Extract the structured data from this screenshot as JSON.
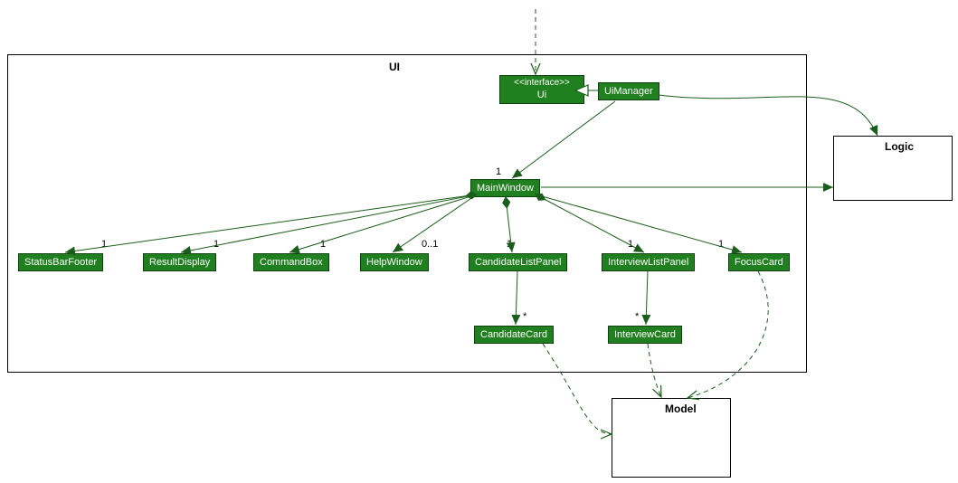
{
  "packages": {
    "ui_label": "UI",
    "logic_label": "Logic",
    "model_label": "Model"
  },
  "classes": {
    "ui_interface_stereo": "<<interface>>",
    "ui_interface_name": "Ui",
    "ui_manager": "UiManager",
    "main_window": "MainWindow",
    "status_bar_footer": "StatusBarFooter",
    "result_display": "ResultDisplay",
    "command_box": "CommandBox",
    "help_window": "HelpWindow",
    "candidate_list_panel": "CandidateListPanel",
    "interview_list_panel": "InterviewListPanel",
    "focus_card": "FocusCard",
    "candidate_card": "CandidateCard",
    "interview_card": "InterviewCard"
  },
  "multiplicities": {
    "main_window_top": "1",
    "status_bar_footer": "1",
    "result_display": "1",
    "command_box": "1",
    "help_window": "0..1",
    "candidate_list_panel": "1",
    "interview_list_panel": "1",
    "focus_card": "1",
    "candidate_card": "*",
    "interview_card": "*"
  },
  "chart_data": {
    "type": "uml_class_diagram",
    "packages": [
      {
        "name": "UI",
        "contains": [
          "Ui",
          "UiManager",
          "MainWindow",
          "StatusBarFooter",
          "ResultDisplay",
          "CommandBox",
          "HelpWindow",
          "CandidateListPanel",
          "InterviewListPanel",
          "FocusCard",
          "CandidateCard",
          "InterviewCard"
        ]
      },
      {
        "name": "Logic",
        "contains": []
      },
      {
        "name": "Model",
        "contains": []
      }
    ],
    "classes": [
      {
        "name": "Ui",
        "stereotype": "interface"
      },
      {
        "name": "UiManager"
      },
      {
        "name": "MainWindow"
      },
      {
        "name": "StatusBarFooter"
      },
      {
        "name": "ResultDisplay"
      },
      {
        "name": "CommandBox"
      },
      {
        "name": "HelpWindow"
      },
      {
        "name": "CandidateListPanel"
      },
      {
        "name": "InterviewListPanel"
      },
      {
        "name": "FocusCard"
      },
      {
        "name": "CandidateCard"
      },
      {
        "name": "InterviewCard"
      }
    ],
    "relationships": [
      {
        "from": "(external)",
        "to": "Ui",
        "type": "dependency"
      },
      {
        "from": "UiManager",
        "to": "Ui",
        "type": "realization"
      },
      {
        "from": "UiManager",
        "to": "MainWindow",
        "type": "association",
        "multiplicity": "1"
      },
      {
        "from": "UiManager",
        "to": "Logic",
        "type": "association"
      },
      {
        "from": "MainWindow",
        "to": "Logic",
        "type": "association"
      },
      {
        "from": "MainWindow",
        "to": "StatusBarFooter",
        "type": "composition",
        "multiplicity": "1"
      },
      {
        "from": "MainWindow",
        "to": "ResultDisplay",
        "type": "composition",
        "multiplicity": "1"
      },
      {
        "from": "MainWindow",
        "to": "CommandBox",
        "type": "composition",
        "multiplicity": "1"
      },
      {
        "from": "MainWindow",
        "to": "HelpWindow",
        "type": "composition",
        "multiplicity": "0..1"
      },
      {
        "from": "MainWindow",
        "to": "CandidateListPanel",
        "type": "composition",
        "multiplicity": "1"
      },
      {
        "from": "MainWindow",
        "to": "InterviewListPanel",
        "type": "composition",
        "multiplicity": "1"
      },
      {
        "from": "MainWindow",
        "to": "FocusCard",
        "type": "composition",
        "multiplicity": "1"
      },
      {
        "from": "CandidateListPanel",
        "to": "CandidateCard",
        "type": "association",
        "multiplicity": "*"
      },
      {
        "from": "InterviewListPanel",
        "to": "InterviewCard",
        "type": "association",
        "multiplicity": "*"
      },
      {
        "from": "CandidateCard",
        "to": "Model",
        "type": "dependency"
      },
      {
        "from": "InterviewCard",
        "to": "Model",
        "type": "dependency"
      },
      {
        "from": "FocusCard",
        "to": "Model",
        "type": "dependency"
      }
    ]
  }
}
